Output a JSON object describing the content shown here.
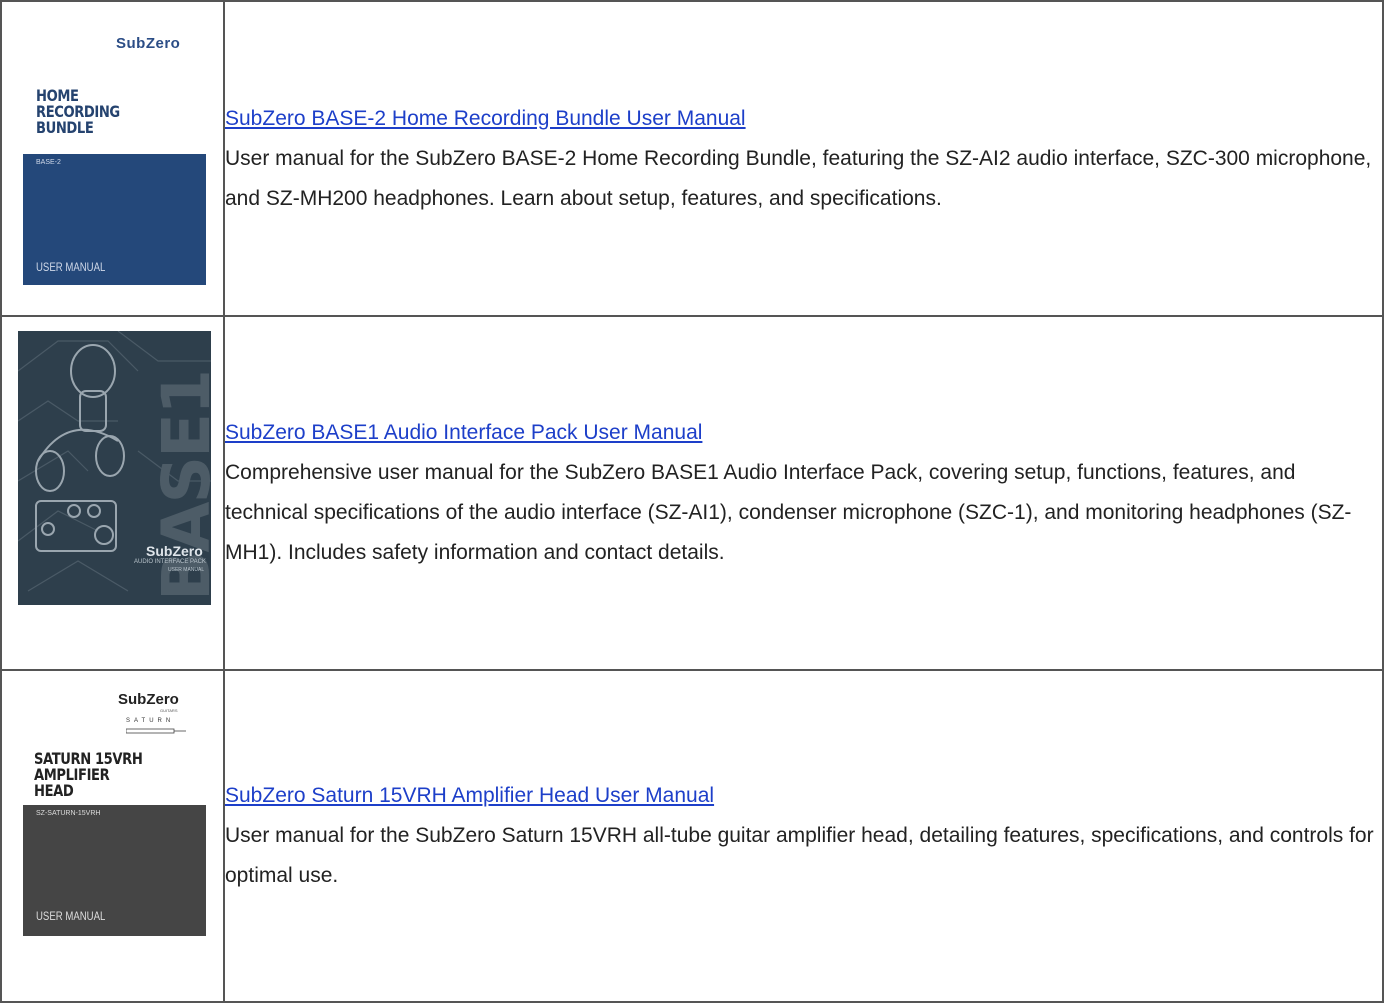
{
  "manuals": [
    {
      "title": "SubZero BASE-2 Home Recording Bundle User Manual",
      "description": "User manual for the SubZero BASE-2 Home Recording Bundle, featuring the SZ-AI2 audio interface, SZC-300 microphone, and SZ-MH200 headphones. Learn about setup, features, and specifications.",
      "cover": {
        "brand": "SubZero",
        "title_lines": [
          "HOME",
          "RECORDING",
          "BUNDLE"
        ],
        "model": "BASE-2",
        "footer": "USER MANUAL",
        "color": "#24487a"
      }
    },
    {
      "title": "SubZero BASE1 Audio Interface Pack User Manual",
      "description": "Comprehensive user manual for the SubZero BASE1 Audio Interface Pack, covering setup, functions, features, and technical specifications of the audio interface (SZ-AI1), condenser microphone (SZC-1), and monitoring headphones (SZ-MH1). Includes safety information and contact details.",
      "cover": {
        "big_text": "BASE1",
        "brand": "SubZero",
        "subtitle": "AUDIO INTERFACE PACK",
        "footer": "USER MANUAL",
        "color": "#2e3f4c"
      }
    },
    {
      "title": "SubZero Saturn 15VRH Amplifier Head User Manual",
      "description": "User manual for the SubZero Saturn 15VRH all-tube guitar amplifier head, detailing features, specifications, and controls for optimal use.",
      "cover": {
        "brand": "SubZero",
        "brand_sub": "GUITARS",
        "product_logo": "SATURN",
        "title_lines": [
          "SATURN 15VRH",
          "AMPLIFIER",
          "HEAD"
        ],
        "model": "SZ-SATURN-15VRH",
        "footer": "USER MANUAL",
        "color": "#454545"
      }
    }
  ]
}
